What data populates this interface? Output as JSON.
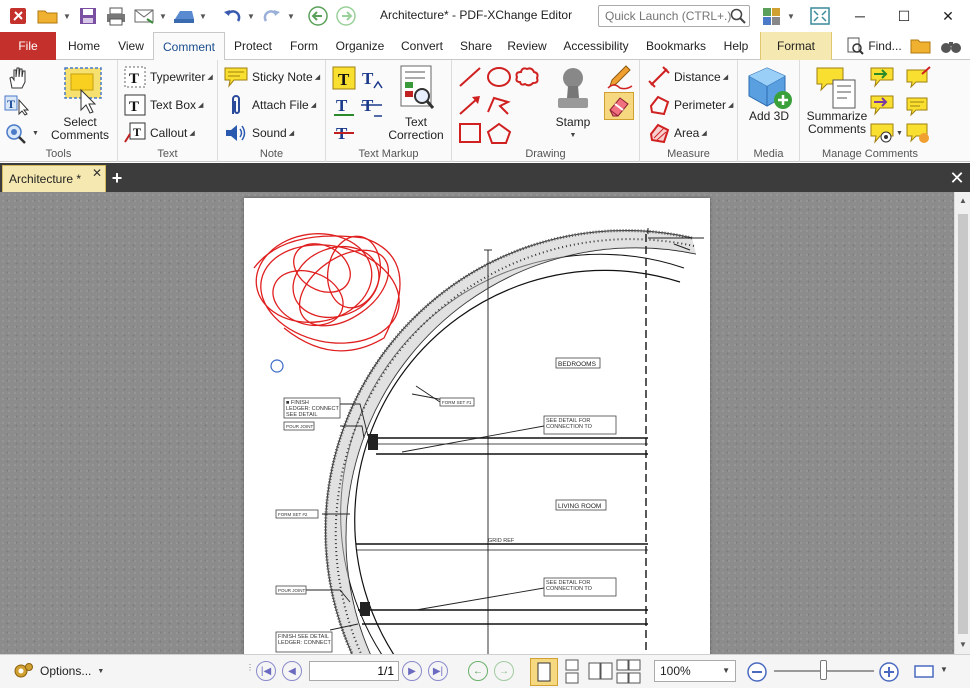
{
  "window": {
    "title": "Architecture* - PDF-XChange Editor",
    "quick_launch_placeholder": "Quick Launch (CTRL+.)"
  },
  "ribbon_tabs": {
    "file": "File",
    "home": "Home",
    "view": "View",
    "comment": "Comment",
    "protect": "Protect",
    "form": "Form",
    "organize": "Organize",
    "convert": "Convert",
    "share": "Share",
    "review": "Review",
    "accessibility": "Accessibility",
    "bookmarks": "Bookmarks",
    "help": "Help",
    "format": "Format",
    "find": "Find..."
  },
  "ribbon": {
    "tools": {
      "label": "Tools",
      "select_comments": "Select Comments"
    },
    "text": {
      "label": "Text",
      "typewriter": "Typewriter",
      "text_box": "Text Box",
      "callout": "Callout"
    },
    "note": {
      "label": "Note",
      "sticky_note": "Sticky Note",
      "attach_file": "Attach File",
      "sound": "Sound"
    },
    "text_markup": {
      "label": "Text Markup",
      "text_correction": "Text Correction"
    },
    "drawing": {
      "label": "Drawing",
      "stamp": "Stamp"
    },
    "measure": {
      "label": "Measure",
      "distance": "Distance",
      "perimeter": "Perimeter",
      "area": "Area"
    },
    "media": {
      "label": "Media",
      "add_3d": "Add 3D"
    },
    "manage_comments": {
      "label": "Manage Comments",
      "summarize_comments": "Summarize Comments"
    }
  },
  "document_tab": {
    "name": "Architecture *"
  },
  "drawing_labels": {
    "bedrooms": "BEDROOMS",
    "living_room": "LIVING ROOM",
    "form_set": "FORM SET #1",
    "form_set2": "FORM SET #2",
    "pour_joint": "POUR JOINT",
    "pour_joint2": "POUR JOINT"
  },
  "statusbar": {
    "options": "Options...",
    "page_value": "1/1",
    "zoom_value": "100%"
  },
  "colors": {
    "file_tab": "#c4302b",
    "format_tab": "#f5e8b0",
    "ink": "#e02020",
    "canvas": "#8c8c8c"
  }
}
